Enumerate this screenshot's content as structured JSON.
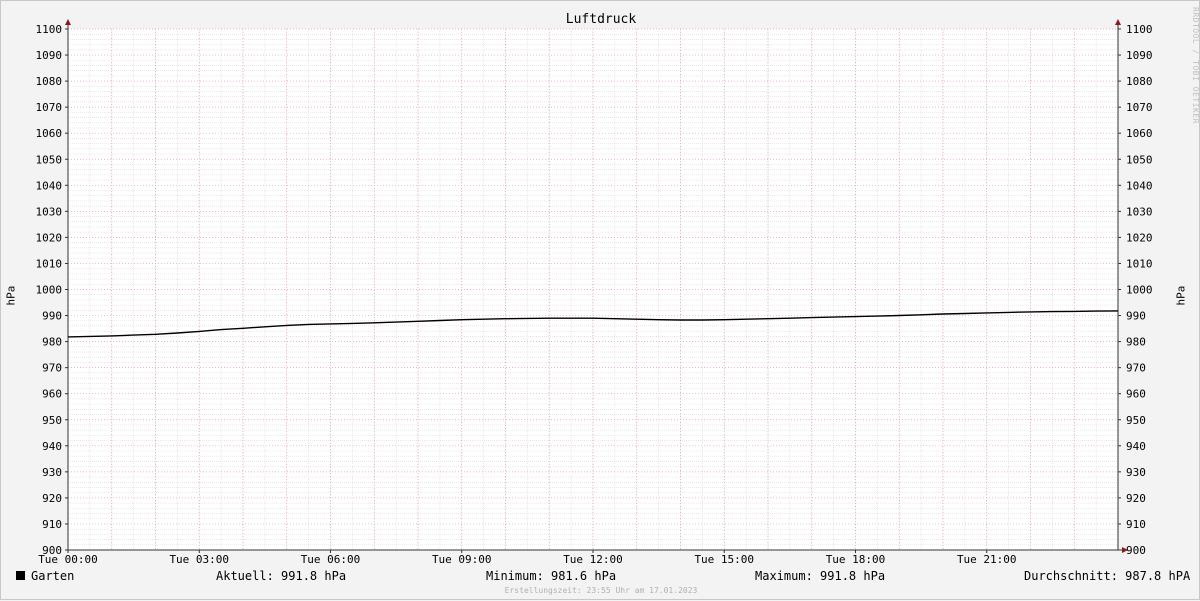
{
  "chart_data": {
    "type": "line",
    "title": "Luftdruck",
    "ylabel": "hPa",
    "ylim": [
      900,
      1100
    ],
    "ytick_step": 10,
    "xlim_hours": [
      0,
      24
    ],
    "xticks": [
      {
        "hour": 0,
        "label": "Tue 00:00"
      },
      {
        "hour": 3,
        "label": "Tue 03:00"
      },
      {
        "hour": 6,
        "label": "Tue 06:00"
      },
      {
        "hour": 9,
        "label": "Tue 09:00"
      },
      {
        "hour": 12,
        "label": "Tue 12:00"
      },
      {
        "hour": 15,
        "label": "Tue 15:00"
      },
      {
        "hour": 18,
        "label": "Tue 18:00"
      },
      {
        "hour": 21,
        "label": "Tue 21:00"
      }
    ],
    "grid": true,
    "series": [
      {
        "name": "Garten",
        "color": "#000000",
        "hours": [
          0,
          0.5,
          1,
          1.5,
          2,
          2.5,
          3,
          3.5,
          4,
          4.5,
          5,
          5.5,
          6,
          6.5,
          7,
          7.5,
          8,
          8.5,
          9,
          9.5,
          10,
          10.5,
          11,
          11.5,
          12,
          12.5,
          13,
          13.5,
          14,
          14.5,
          15,
          15.5,
          16,
          16.5,
          17,
          17.5,
          18,
          18.5,
          19,
          19.5,
          20,
          20.5,
          21,
          21.5,
          22,
          22.5,
          23,
          23.5,
          24
        ],
        "values": [
          981.8,
          982.0,
          982.2,
          982.5,
          982.8,
          983.3,
          983.9,
          984.6,
          985.1,
          985.7,
          986.2,
          986.6,
          986.8,
          987.0,
          987.2,
          987.5,
          987.8,
          988.1,
          988.4,
          988.6,
          988.8,
          988.9,
          989.0,
          989.0,
          989.0,
          988.8,
          988.6,
          988.4,
          988.3,
          988.3,
          988.4,
          988.6,
          988.8,
          989.0,
          989.2,
          989.4,
          989.6,
          989.8,
          990.0,
          990.3,
          990.6,
          990.8,
          991.0,
          991.2,
          991.4,
          991.5,
          991.6,
          991.7,
          991.8
        ]
      }
    ],
    "legend": {
      "series_name": "Garten",
      "current": "Aktuell: 991.8 hPa",
      "minimum": "Minimum: 981.6 hPa",
      "maximum": "Maximum: 991.8 hPa",
      "average": "Durchschnitt: 987.8 hPA"
    },
    "watermark": "RRDTOOL / TOBI OETIKER",
    "footer": "Erstellungszeit: 23:55 Uhr am 17.01.2023"
  }
}
